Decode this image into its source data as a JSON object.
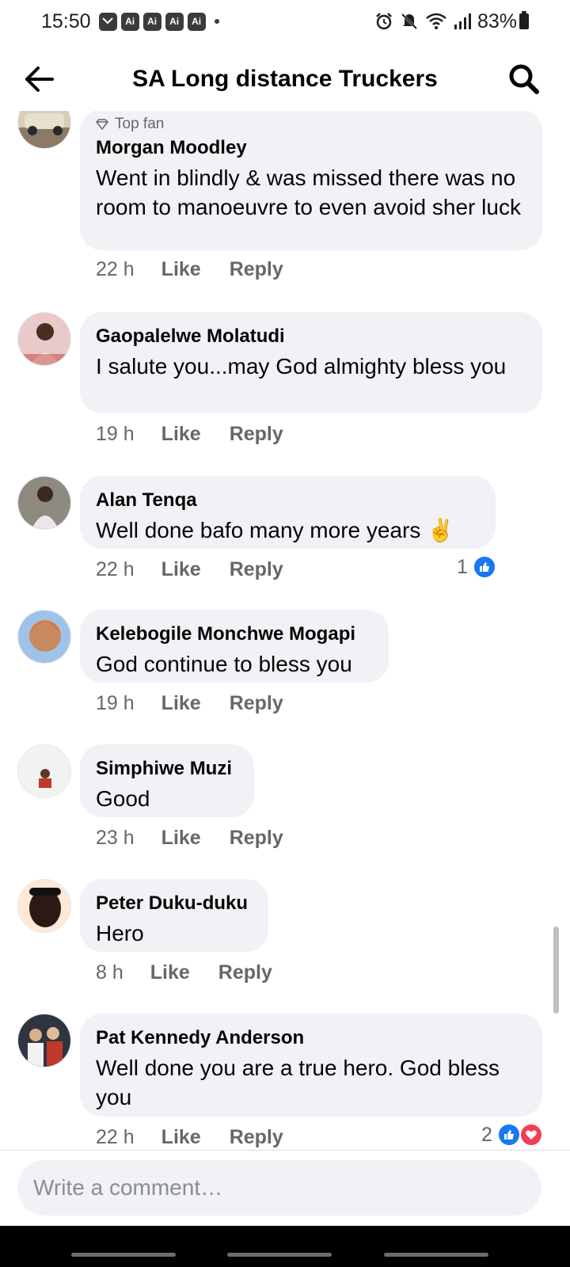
{
  "status_bar": {
    "time": "15:50",
    "badges": [
      "Ai",
      "Ai",
      "Ai",
      "Ai"
    ],
    "battery": "83%"
  },
  "header": {
    "title": "SA Long distance Truckers"
  },
  "comments": [
    {
      "badge": "Top fan",
      "author": "Morgan Moodley",
      "text": "Went in blindly & was missed there was no room to manoeuvre to even avoid sher luck",
      "time": "22 h",
      "like": "Like",
      "reply": "Reply"
    },
    {
      "author": "Gaopalelwe Molatudi",
      "text": "I salute you...may God almighty bless you",
      "time": "19 h",
      "like": "Like",
      "reply": "Reply"
    },
    {
      "author": "Alan Tenqa",
      "text": "Well done bafo many more years ✌️",
      "time": "22 h",
      "like": "Like",
      "reply": "Reply",
      "reaction_count": "1"
    },
    {
      "author": "Kelebogile Monchwe Mogapi",
      "text": "God continue to bless you",
      "time": "19 h",
      "like": "Like",
      "reply": "Reply"
    },
    {
      "author": "Simphiwe Muzi",
      "text": "Good",
      "time": "23 h",
      "like": "Like",
      "reply": "Reply"
    },
    {
      "author": "Peter Duku-duku",
      "text": "Hero",
      "time": "8 h",
      "like": "Like",
      "reply": "Reply"
    },
    {
      "author": "Pat Kennedy Anderson",
      "text": "Well done you are a true hero. God bless you",
      "time": "22 h",
      "like": "Like",
      "reply": "Reply",
      "reaction_count": "2"
    }
  ],
  "composer": {
    "placeholder": "Write a comment…"
  },
  "colors": {
    "accent": "#1877f2",
    "love": "#f33e58",
    "bubble": "#f0f2f5",
    "secondary_text": "#65676b"
  }
}
